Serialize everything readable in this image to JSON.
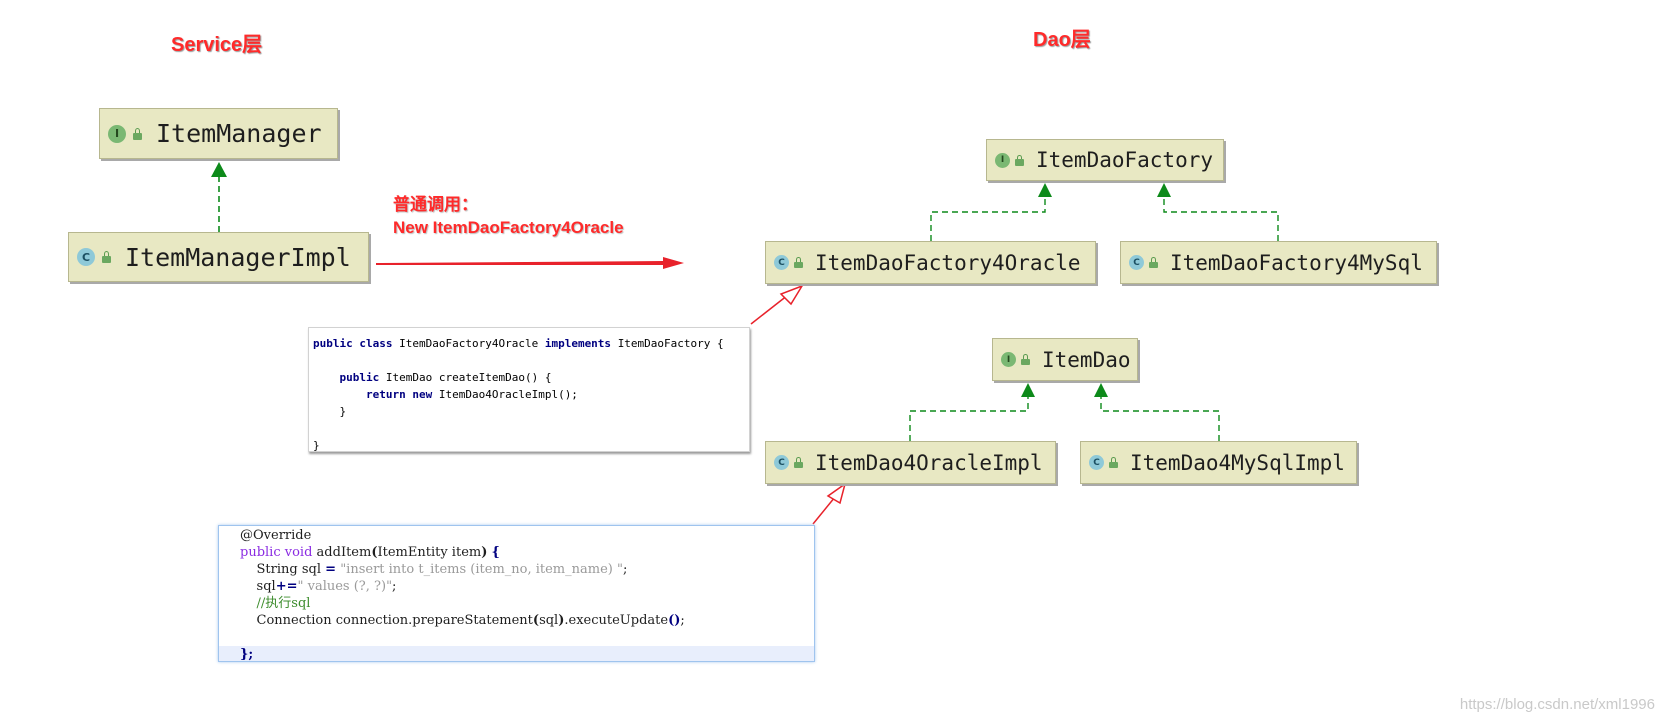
{
  "titles": {
    "service": "Service层",
    "dao": "Dao层"
  },
  "classes": {
    "item_manager": {
      "label": "ItemManager",
      "kind": "I"
    },
    "item_manager_impl": {
      "label": "ItemManagerImpl",
      "kind": "C"
    },
    "item_dao_factory": {
      "label": "ItemDaoFactory",
      "kind": "I"
    },
    "item_dao_factory_oracle": {
      "label": "ItemDaoFactory4Oracle",
      "kind": "C"
    },
    "item_dao_factory_mysql": {
      "label": "ItemDaoFactory4MySql",
      "kind": "C"
    },
    "item_dao": {
      "label": "ItemDao",
      "kind": "I"
    },
    "item_dao_oracle_impl": {
      "label": "ItemDao4OracleImpl",
      "kind": "C"
    },
    "item_dao_mysql_impl": {
      "label": "ItemDao4MySqlImpl",
      "kind": "C"
    }
  },
  "call_note": {
    "line1": "普通调用：",
    "line2": "New ItemDaoFactory4Oracle"
  },
  "code_factory": {
    "l1_kw1": "public",
    "l1_kw2": "class",
    "l1_name": "ItemDaoFactory4Oracle",
    "l1_kw3": "implements",
    "l1_rest": "ItemDaoFactory {",
    "l3_kw": "public",
    "l3_rest": "ItemDao createItemDao() {",
    "l4_kw1": "return",
    "l4_kw2": "new",
    "l4_rest": "ItemDao4OracleImpl();",
    "l5": "}",
    "l7": "}"
  },
  "code_additem": {
    "l1": "@Override",
    "l2_kw": "public void",
    "l2_name": "addItem",
    "l2_paren_open": "(",
    "l2_params": "ItemEntity item",
    "l2_paren_close": ")",
    "l2_brace": "{",
    "l3_a": "String sql ",
    "l3_eq": "=",
    "l3_str": "\"insert into t_items (item_no, item_name) \"",
    "l3_end": ";",
    "l4_a": "sql",
    "l4_op": "+=",
    "l4_str": "\" values (?, ?)\"",
    "l4_end": ";",
    "l5": "//执行sql",
    "l6_a": "Connection connection.prepareStatement",
    "l6_p1": "(",
    "l6_b": "sql",
    "l6_p2": ")",
    "l6_c": ".executeUpdate",
    "l6_p3": "()",
    "l6_end": ";",
    "l8": "};"
  },
  "watermark": "https://blog.csdn.net/xml1996",
  "colors": {
    "accent_red": "#ff2a2a",
    "uml_box_bg": "#e8e8c3",
    "inheritance_green": "#0d8a1a",
    "interface_badge": "#7ab873",
    "class_badge": "#8ec9d8"
  },
  "icons": {
    "interface": "interface-badge-icon",
    "class": "class-badge-icon",
    "visibility": "public-lock-icon"
  }
}
